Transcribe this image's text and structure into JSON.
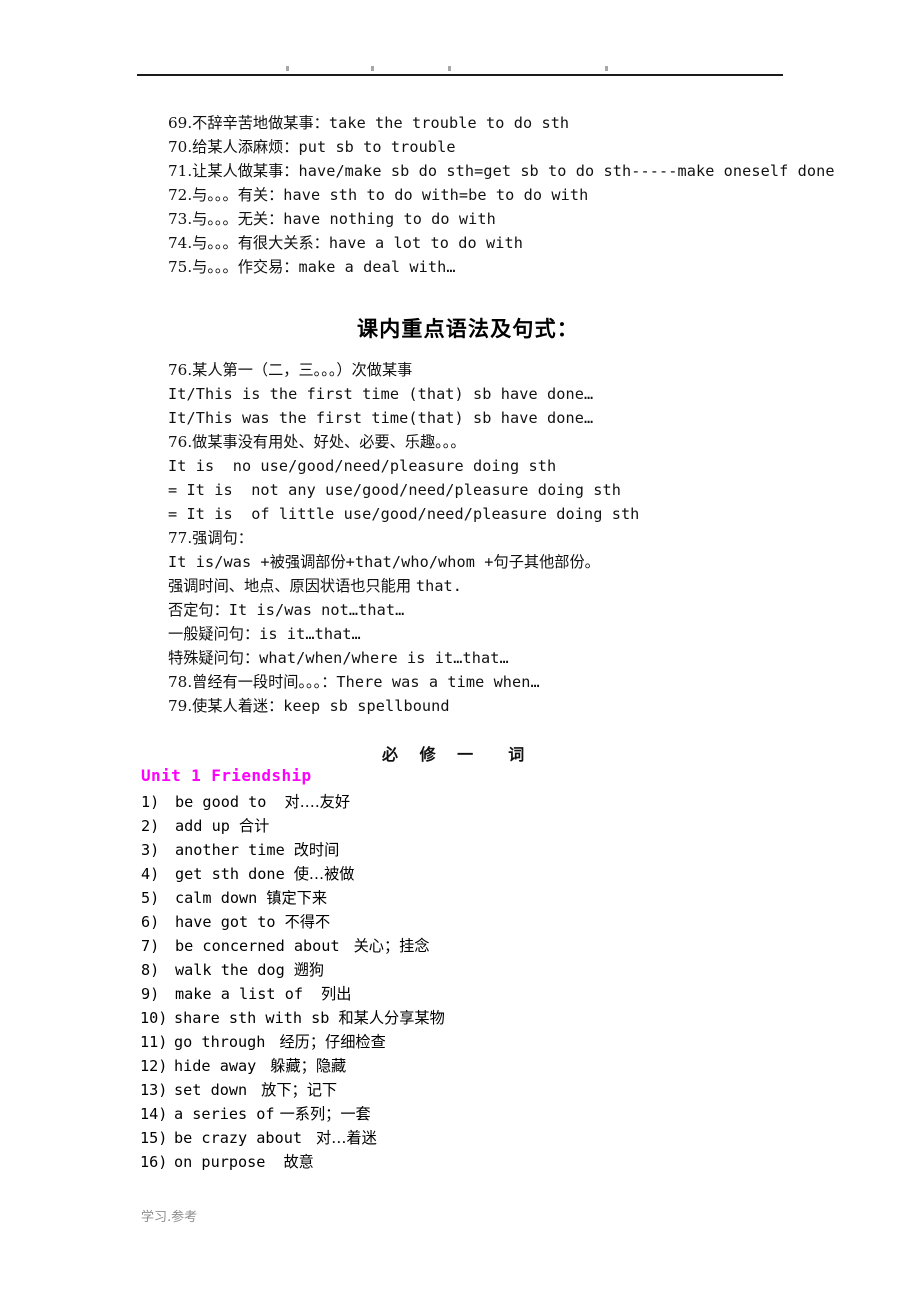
{
  "header": {
    "marks": [
      "·",
      "·",
      "·",
      "·"
    ],
    "rule_color": "#1b1b1b"
  },
  "top_block": {
    "lines": [
      {
        "num": "69.",
        "cn": "不辞辛苦地做某事：",
        "en": "take the trouble to do sth"
      },
      {
        "num": "70.",
        "cn": "给某人添麻烦：",
        "en": "put sb to trouble"
      },
      {
        "num": "71.",
        "cn": "让某人做某事：",
        "en": "have/make sb do sth=get sb to do sth-----make oneself done"
      },
      {
        "num": "72.",
        "cn": "与。。。有关：",
        "en": "have sth to do with=be to do with"
      },
      {
        "num": "73.",
        "cn": "与。。。无关：",
        "en": "have nothing to do with"
      },
      {
        "num": "74.",
        "cn": "与。。。有很大关系：",
        "en": "have a lot to do with"
      },
      {
        "num": "75.",
        "cn": "与。。。作交易：",
        "en": "make a deal with…"
      }
    ]
  },
  "grammar_title": "课内重点语法及句式：",
  "grammar_block": {
    "lines": [
      {
        "num": "76.",
        "cn": "某人第一（二，三。。。）次做某事",
        "en": ""
      },
      {
        "num": "",
        "cn": "",
        "en": "It/This is the first time (that) sb have done…"
      },
      {
        "num": "",
        "cn": "",
        "en": "It/This was the first time(that) sb have done…"
      },
      {
        "num": "76.",
        "cn": "做某事没有用处、好处、必要、乐趣。。。",
        "en": ""
      },
      {
        "num": "",
        "cn": "",
        "en": "It is  no use/good/need/pleasure doing sth"
      },
      {
        "num": "",
        "cn": "",
        "en": "= It is  not any use/good/need/pleasure doing sth"
      },
      {
        "num": "",
        "cn": "",
        "en": "= It is  of little use/good/need/pleasure doing sth"
      },
      {
        "num": "77.",
        "cn": "强调句：",
        "en": ""
      },
      {
        "num": "",
        "cn": "",
        "en": "It is/was +",
        "cn2": "被强调部份",
        "en2": "+that/who/whom +",
        "cn3": "句子其他部份。"
      },
      {
        "num": "",
        "cn": "强调时间、地点、原因状语也只能用 ",
        "en": "that."
      },
      {
        "num": "",
        "cn": "否定句：",
        "en": "It is/was not…that…"
      },
      {
        "num": "",
        "cn": "一般疑问句：",
        "en": "is it…that…"
      },
      {
        "num": "",
        "cn": "特殊疑问句：",
        "en": "what/when/where is it…that…"
      },
      {
        "num": "78.",
        "cn": "曾经有一段时间。。。：",
        "en": "There was a time when…"
      },
      {
        "num": "79.",
        "cn": "使某人着迷：",
        "en": "keep sb spellbound"
      }
    ]
  },
  "sub_heading": "必 修 一  词",
  "unit_heading": {
    "label": "Unit 1 Friendship",
    "color": "#FF00FF"
  },
  "vocab": [
    {
      "num": "1)",
      "en": "be good to",
      "cn": "对….友好"
    },
    {
      "num": "2)",
      "en": "add up",
      "cn": "合计"
    },
    {
      "num": "3)",
      "en": "another time",
      "cn": "改时间"
    },
    {
      "num": "4)",
      "en": "get sth done",
      "cn": "使…被做"
    },
    {
      "num": "5)",
      "en": "calm down",
      "cn": "镇定下来"
    },
    {
      "num": "6)",
      "en": "have got to",
      "cn": "不得不"
    },
    {
      "num": "7)",
      "en": "be concerned about",
      "cn": "关心；挂念"
    },
    {
      "num": "8)",
      "en": "walk the dog",
      "cn": "遡狗"
    },
    {
      "num": "9)",
      "en": "make a list of",
      "cn": "列出"
    },
    {
      "num": "10)",
      "en": "share sth with sb",
      "cn": "和某人分享某物"
    },
    {
      "num": "11)",
      "en": "go through",
      "cn": "经历；仔细检查"
    },
    {
      "num": "12)",
      "en": "hide away",
      "cn": "躲藏；隐藏"
    },
    {
      "num": "13)",
      "en": "set down",
      "cn": "放下；记下"
    },
    {
      "num": "14)",
      "en": "a series of",
      "cn": "一系列；一套"
    },
    {
      "num": "15)",
      "en": "be crazy about",
      "cn": "对…着迷"
    },
    {
      "num": "16)",
      "en": "on purpose",
      "cn": "故意"
    }
  ],
  "footer": "学习.参考"
}
